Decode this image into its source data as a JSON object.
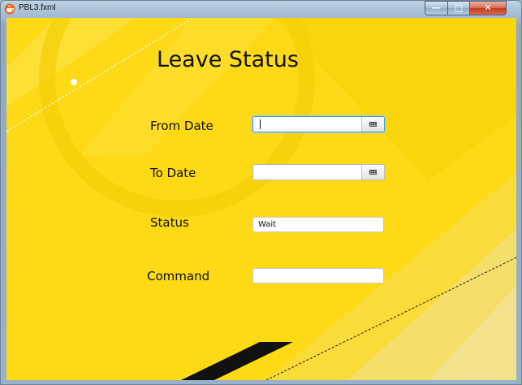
{
  "window": {
    "title": "PBL3.fxml",
    "icons": {
      "app": "java-cup-icon",
      "minimize": "minimize-icon",
      "maximize": "maximize-icon",
      "close": "close-icon"
    },
    "controls": {
      "minimize_glyph": "—",
      "maximize_glyph": "□",
      "close_glyph": "✕"
    }
  },
  "form": {
    "heading": "Leave Status",
    "from_date": {
      "label": "From Date",
      "value": "",
      "icon": "calendar-icon"
    },
    "to_date": {
      "label": "To Date",
      "value": "",
      "icon": "calendar-icon"
    },
    "status": {
      "label": "Status",
      "value": "Wait"
    },
    "command": {
      "label": "Command",
      "value": ""
    }
  },
  "colors": {
    "background": "#fdd916",
    "focus": "#3a99d6",
    "close_button": "#c23a1d"
  }
}
